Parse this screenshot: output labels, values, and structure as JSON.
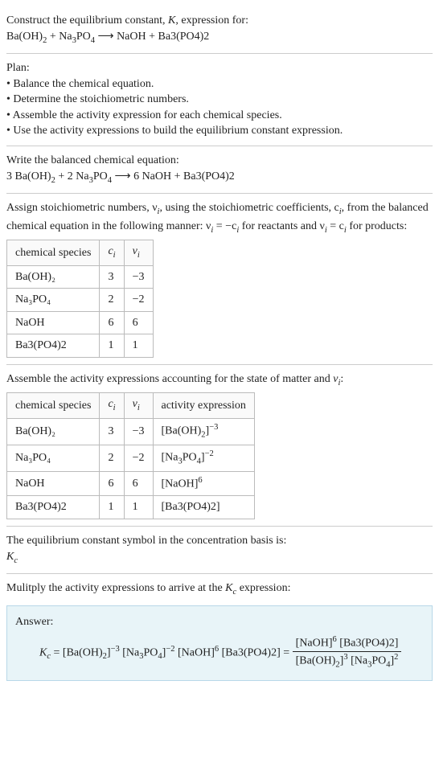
{
  "s1": {
    "line1": "Construct the equilibrium constant, K, expression for:",
    "line2_left": "Ba(OH)",
    "line2_plus1": " + Na",
    "line2_po4": "PO",
    "line2_arrow": "  ⟶  NaOH + Ba3(PO4)2"
  },
  "s2": {
    "title": "Plan:",
    "b1": "• Balance the chemical equation.",
    "b2": "• Determine the stoichiometric numbers.",
    "b3": "• Assemble the activity expression for each chemical species.",
    "b4": "• Use the activity expressions to build the equilibrium constant expression."
  },
  "s3": {
    "title": "Write the balanced chemical equation:",
    "eq_a": "3 Ba(OH)",
    "eq_b": " + 2 Na",
    "eq_c": "PO",
    "eq_d": "  ⟶  6 NaOH + Ba3(PO4)2"
  },
  "s4": {
    "p1a": "Assign stoichiometric numbers, ν",
    "p1b": ", using the stoichiometric coefficients, c",
    "p1c": ", from the balanced chemical equation in the following manner: ν",
    "p1d": " = −c",
    "p1e": " for reactants and ν",
    "p1f": " = c",
    "p1g": " for products:",
    "h1": "chemical species",
    "h2": "cᵢ",
    "h3": "νᵢ",
    "r1c1": "Ba(OH)₂",
    "r1c2": "3",
    "r1c3": "−3",
    "r2c1": "Na₃PO₄",
    "r2c2": "2",
    "r2c3": "−2",
    "r3c1": "NaOH",
    "r3c2": "6",
    "r3c3": "6",
    "r4c1": "Ba3(PO4)2",
    "r4c2": "1",
    "r4c3": "1"
  },
  "s5": {
    "title": "Assemble the activity expressions accounting for the state of matter and νᵢ:",
    "h1": "chemical species",
    "h2": "cᵢ",
    "h3": "νᵢ",
    "h4": "activity expression",
    "r1c1": "Ba(OH)₂",
    "r1c2": "3",
    "r1c3": "−3",
    "r1c4a": "[Ba(OH)",
    "r1c4b": "]",
    "r1c4exp": "−3",
    "r2c1": "Na₃PO₄",
    "r2c2": "2",
    "r2c3": "−2",
    "r2c4a": "[Na",
    "r2c4b": "PO",
    "r2c4c": "]",
    "r2c4exp": "−2",
    "r3c1": "NaOH",
    "r3c2": "6",
    "r3c3": "6",
    "r3c4a": "[NaOH]",
    "r3c4exp": "6",
    "r4c1": "Ba3(PO4)2",
    "r4c2": "1",
    "r4c3": "1",
    "r4c4": "[Ba3(PO4)2]"
  },
  "s6": {
    "line1": "The equilibrium constant symbol in the concentration basis is:",
    "sym": "K",
    "sub": "c"
  },
  "s7": {
    "title": "Mulitply the activity expressions to arrive at the Kc expression:",
    "answer": "Answer:",
    "kc": "K",
    "kcsub": "c",
    "eq_eq": " = [Ba(OH)",
    "eq_t1b": "]",
    "eq_e1": "−3",
    "eq_t2a": " [Na",
    "eq_t2b": "PO",
    "eq_t2c": "]",
    "eq_e2": "−2",
    "eq_t3a": " [NaOH]",
    "eq_e3": "6",
    "eq_t4": " [Ba3(PO4)2] = ",
    "num_a": "[NaOH]",
    "num_e": "6",
    "num_b": " [Ba3(PO4)2]",
    "den_a": "[Ba(OH)",
    "den_b": "]",
    "den_e1": "3",
    "den_c": " [Na",
    "den_d": "PO",
    "den_e": "]",
    "den_e2": "2"
  }
}
